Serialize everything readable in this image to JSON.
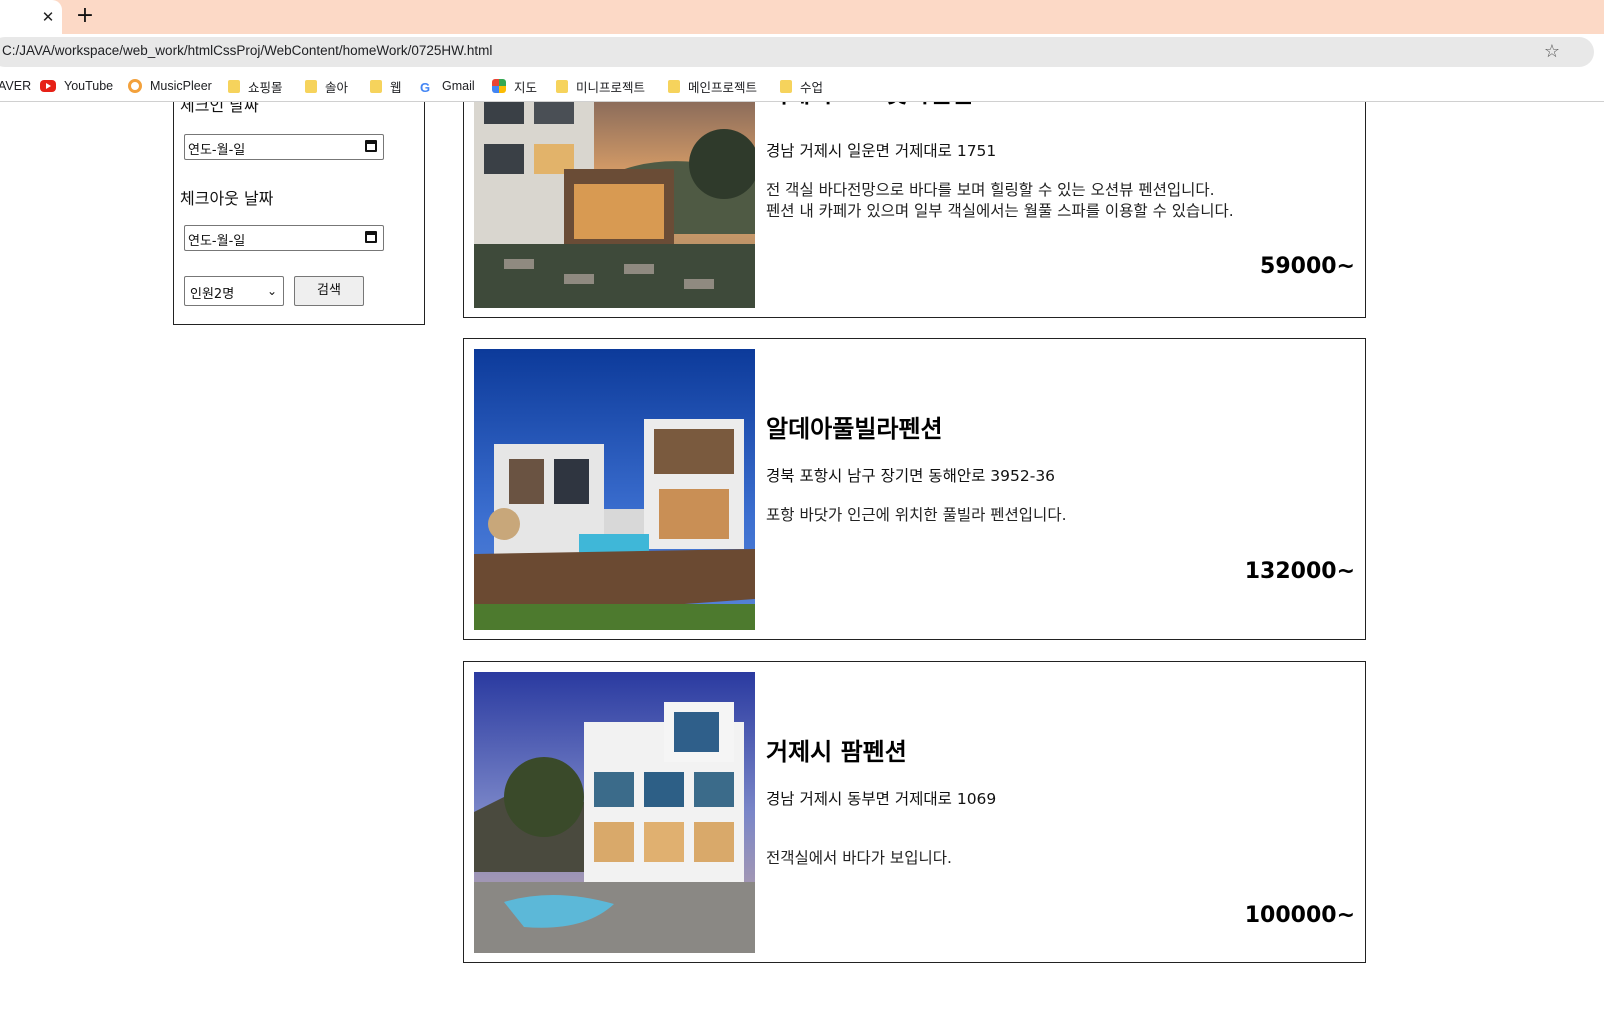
{
  "browser": {
    "new_tab_label": "+",
    "close_tab_label": "✕",
    "url": "C:/JAVA/workspace/web_work/htmlCssProj/WebContent/homeWork/0725HW.html",
    "bookmarks": [
      {
        "label": "AVER",
        "icon": "none"
      },
      {
        "label": "YouTube",
        "icon": "youtube-icon"
      },
      {
        "label": "MusicPleer",
        "icon": "musicpleer-icon"
      },
      {
        "label": "쇼핑몰",
        "icon": "folder-icon"
      },
      {
        "label": "솔아",
        "icon": "folder-icon"
      },
      {
        "label": "웹",
        "icon": "folder-icon"
      },
      {
        "label": "Gmail",
        "icon": "google-icon"
      },
      {
        "label": "지도",
        "icon": "maps-icon"
      },
      {
        "label": "미니프로젝트",
        "icon": "folder-icon"
      },
      {
        "label": "메인프로젝트",
        "icon": "folder-icon"
      },
      {
        "label": "수업",
        "icon": "folder-icon"
      }
    ]
  },
  "search_panel": {
    "checkin_label": "체크인 날짜",
    "checkin_value": "연도-월-일",
    "checkout_label": "체크아웃 날짜",
    "checkout_value": "연도-월-일",
    "guests_selected": "인원2명",
    "search_button": "검색"
  },
  "listings": [
    {
      "title": "거제시 포르젯시펜션",
      "address": "경남 거제시 일운면 거제대로 1751",
      "description": [
        "전 객실 바다전망으로 바다를 보며 힐링할 수 있는 오션뷰 펜션입니다.",
        "펜션 내 카페가 있으며 일부 객실에서는 월풀 스파를 이용할 수 있습니다."
      ],
      "price": "59000~"
    },
    {
      "title": "알데아풀빌라펜션",
      "address": "경북 포항시 남구 장기면 동해안로 3952-36",
      "description": [
        "포항 바닷가 인근에 위치한 풀빌라 펜션입니다."
      ],
      "price": "132000~"
    },
    {
      "title": "거제시 팜펜션",
      "address": "경남 거제시 동부면 거제대로 1069",
      "description": [
        "전객실에서 바다가 보입니다."
      ],
      "price": "100000~"
    }
  ],
  "colors": {
    "tabstrip": "#fcd9c6",
    "omnibox": "#e8e8e8",
    "border": "#222222"
  }
}
